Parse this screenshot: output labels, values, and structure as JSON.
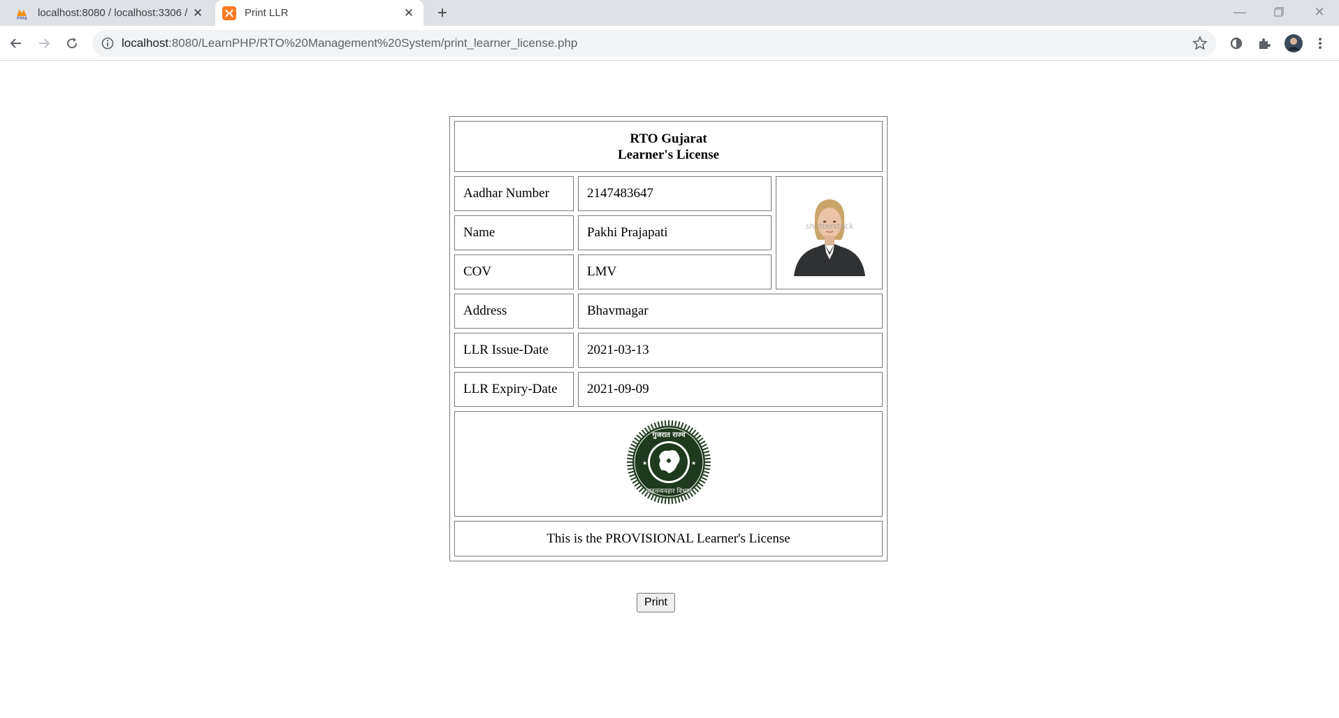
{
  "browser": {
    "tabs": [
      {
        "title": "localhost:8080 / localhost:3306 /",
        "icon": "phpmyadmin-icon",
        "active": false
      },
      {
        "title": "Print LLR",
        "icon": "xampp-icon",
        "active": true
      }
    ],
    "url": {
      "host": "localhost",
      "rest": ":8080/LearnPHP/RTO%20Management%20System/print_learner_license.php"
    }
  },
  "license": {
    "header_line1": "RTO Gujarat",
    "header_line2": "Learner's License",
    "rows": [
      {
        "label": "Aadhar Number",
        "value": "2147483647"
      },
      {
        "label": "Name",
        "value": "Pakhi Prajapati"
      },
      {
        "label": "COV",
        "value": "LMV"
      },
      {
        "label": "Address",
        "value": "Bhavmagar"
      },
      {
        "label": "LLR Issue-Date",
        "value": "2021-03-13"
      },
      {
        "label": "LLR Expiry-Date",
        "value": "2021-09-09"
      }
    ],
    "photo_watermark": "shutterstock",
    "seal_text": "गुजरात राज्य वाहनव्यवहार विभाग",
    "footer": "This is the PROVISIONAL Learner's License"
  },
  "print_button_label": "Print",
  "colors": {
    "tabstrip_bg": "#dee1e6",
    "omnibox_bg": "#f1f3f4",
    "seal_green": "#1f3a1e",
    "border": "#7a7a7a"
  }
}
